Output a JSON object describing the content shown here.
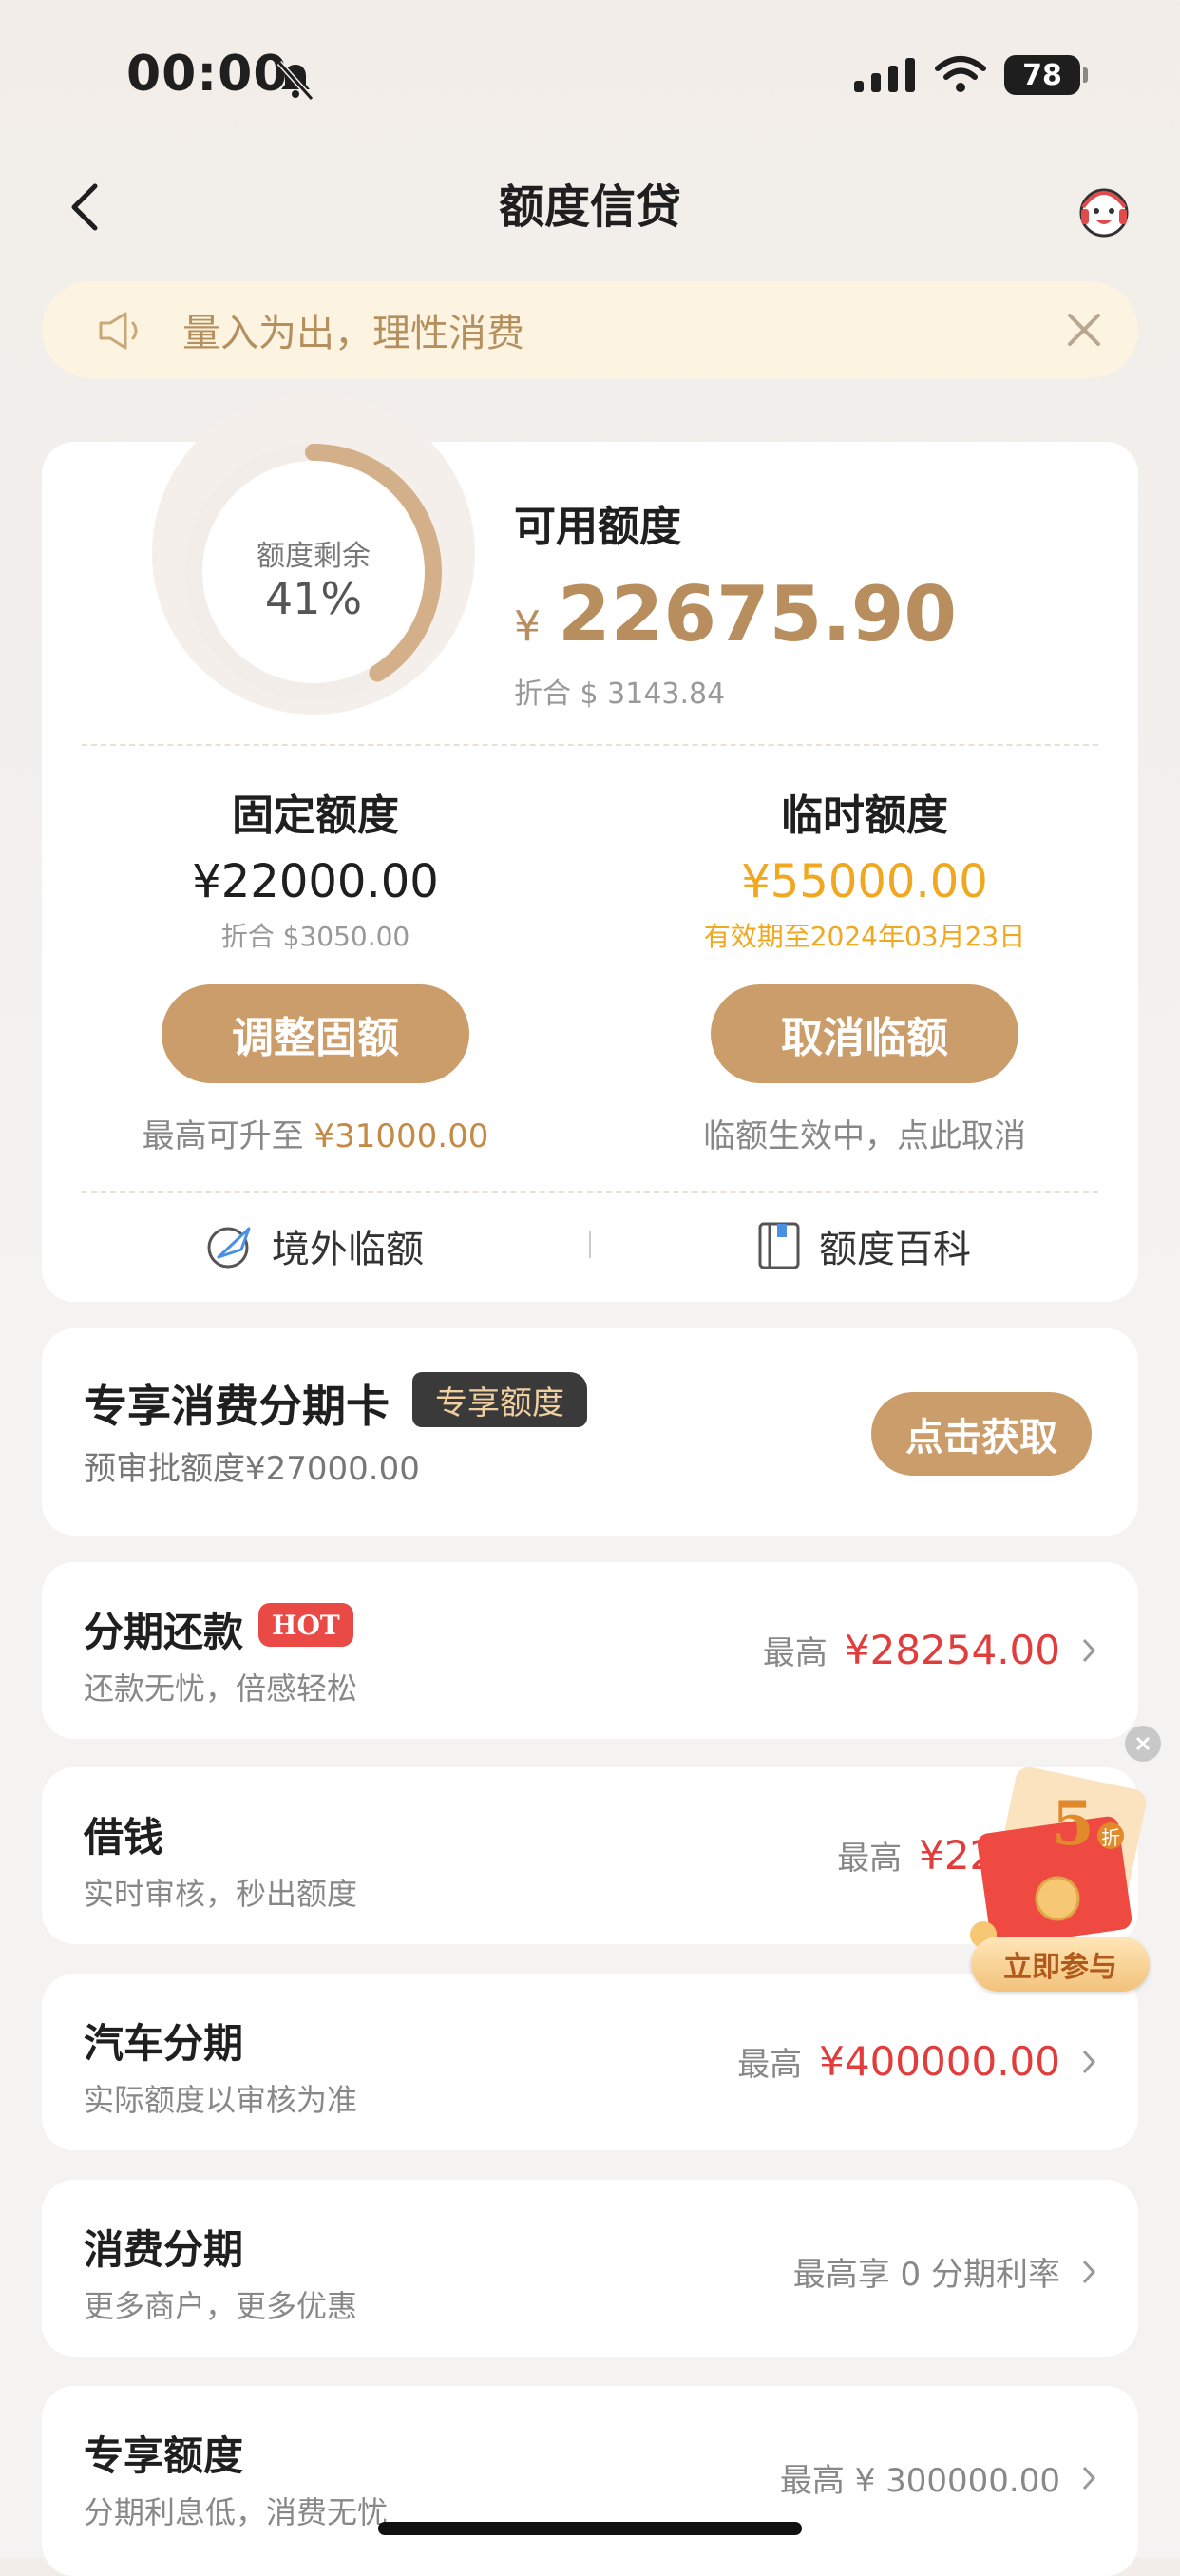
{
  "status_bar": {
    "time": "00:00",
    "battery": "78"
  },
  "header": {
    "title": "额度信贷"
  },
  "notice": {
    "text": "量入为出，理性消费"
  },
  "quota": {
    "ring_label": "额度剩余",
    "ring_percent": "41%",
    "ring_fraction": 0.41,
    "available_label": "可用额度",
    "currency": "¥",
    "available_amount": "22675.90",
    "available_usd": "折合 $ 3143.84",
    "fixed": {
      "title": "固定额度",
      "amount": "¥22000.00",
      "sub": "折合 $3050.00",
      "button": "调整固额",
      "note_prefix": "最高可升至",
      "note_value": "¥31000.00"
    },
    "temp": {
      "title": "临时额度",
      "amount": "¥55000.00",
      "sub": "有效期至2024年03月23日",
      "button": "取消临额",
      "note": "临额生效中，点此取消"
    },
    "links": {
      "overseas": "境外临额",
      "wiki": "额度百科"
    }
  },
  "exclusive": {
    "title": "专享消费分期卡",
    "badge": "专享额度",
    "sub": "预审批额度¥27000.00",
    "button": "点击获取"
  },
  "list": [
    {
      "title": "分期还款",
      "badge": "HOT",
      "sub": "还款无忧，倍感轻松",
      "label": "最高",
      "value": "¥28254.00"
    },
    {
      "title": "借钱",
      "sub": "实时审核，秒出额度",
      "label": "最高",
      "value": "¥220"
    },
    {
      "title": "汽车分期",
      "sub": "实际额度以审核为准",
      "label": "最高",
      "value": "¥400000.00"
    },
    {
      "title": "消费分期",
      "sub": "更多商户，更多优惠",
      "plain": "最高享 0 分期利率"
    },
    {
      "title": "专享额度",
      "sub": "分期利息低，消费无忧",
      "plain": "最高 ¥ 300000.00"
    }
  ],
  "promo": {
    "big": "5",
    "small": "折",
    "button": "立即参与"
  }
}
